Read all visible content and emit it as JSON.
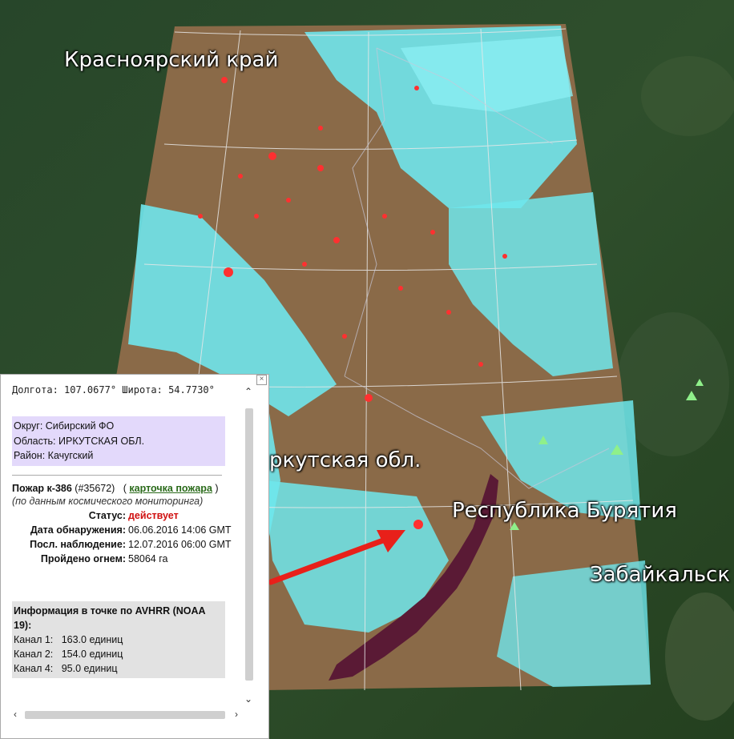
{
  "map": {
    "regions": [
      {
        "id": "krasnoyarsk",
        "label": "Красноярский край"
      },
      {
        "id": "irkutsk",
        "label": "ркутская обл."
      },
      {
        "id": "buryatia",
        "label": "Республика Бурятия"
      },
      {
        "id": "zabaikalsky",
        "label": "Забайкальск"
      }
    ],
    "colors": {
      "forest": "#2b4a2b",
      "overlay": "#8a6a48",
      "cloud": "#6ee8ee",
      "lake": "#5a1a35",
      "arrow": "#e8201a",
      "fire": "#ff3030"
    }
  },
  "popup": {
    "close": "×",
    "coords": "Долгота: 107.0677°  Широта: 54.7730°",
    "district": "Округ: Сибирский ФО",
    "region": "Область: ИРКУТСКАЯ ОБЛ.",
    "area": "Район: Качугский",
    "fire_title": "Пожар к-386",
    "fire_id": "(#35672)",
    "open_paren": "(",
    "card_link": "карточка пожара",
    "close_paren": ")",
    "source_note": "(по данным космического мониторинга)",
    "status_label": "Статус:",
    "status_value": "действует",
    "detect_label": "Дата обнаружения:",
    "detect_value": "06.06.2016 14:06 GMT",
    "last_label": "Посл. наблюдение:",
    "last_value": "12.07.2016 06:00 GMT",
    "burned_label": "Пройдено огнем:",
    "burned_value": "58064 га",
    "avhrr_title": "Информация в точке по AVHRR (NOAA 19):",
    "ch1": "Канал 1:   163.0 единиц",
    "ch2": "Канал 2:   154.0 единиц",
    "ch4": "Канал 4:   95.0 единиц"
  }
}
